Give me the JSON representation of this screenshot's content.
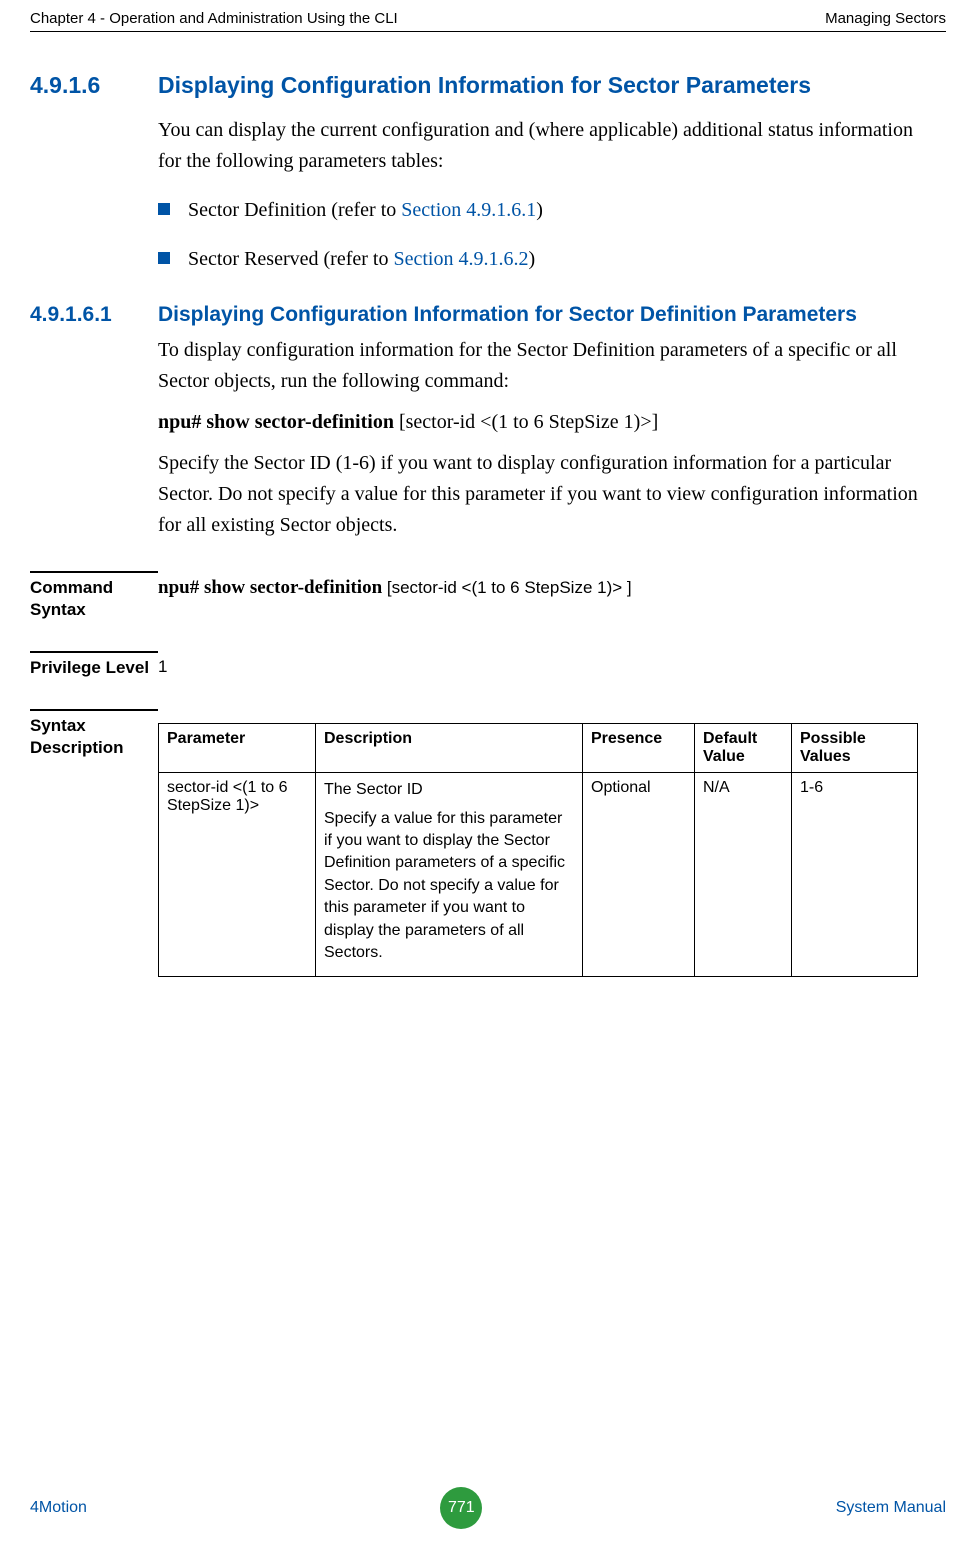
{
  "header": {
    "left": "Chapter 4 - Operation and Administration Using the CLI",
    "right": "Managing Sectors"
  },
  "sec1": {
    "num": "4.9.1.6",
    "title": "Displaying Configuration Information for Sector Parameters",
    "intro": "You can display the current configuration and (where applicable) additional status information for the following parameters tables:",
    "bullet1_pre": "Sector Definition (refer to ",
    "bullet1_link": "Section 4.9.1.6.1",
    "bullet1_post": ")",
    "bullet2_pre": "Sector Reserved (refer to ",
    "bullet2_link": "Section 4.9.1.6.2",
    "bullet2_post": ")"
  },
  "sec2": {
    "num": "4.9.1.6.1",
    "title": "Displaying Configuration Information for Sector Definition Parameters",
    "p1": "To display configuration information for the Sector Definition parameters of a specific or all Sector objects, run the following command:",
    "cmd_bold": "npu# show sector-definition",
    "cmd_rest": " [sector-id <(1 to 6 StepSize 1)>]",
    "p2": "Specify the Sector ID (1-6) if you want to display configuration information for a particular Sector. Do not specify a value for this parameter if you want to view configuration information for all existing Sector objects."
  },
  "defs": {
    "cmd_label": "Command Syntax",
    "cmd_bold": "npu# show sector-definition",
    "cmd_rest": " [sector-id <(1 to 6 StepSize 1)> ]",
    "priv_label": "Privilege Level",
    "priv_value": "1",
    "syn_label": "Syntax Description"
  },
  "table": {
    "headers": {
      "param": "Parameter",
      "desc": "Description",
      "presence": "Presence",
      "default": "Default Value",
      "possible": "Possible Values"
    },
    "row": {
      "param": "sector-id <(1 to 6 StepSize 1)>",
      "desc_p1": "The Sector ID",
      "desc_p2": "Specify a value for this parameter if you want to display the Sector Definition parameters of a specific Sector. Do not specify a value for this parameter if you want to display the parameters of all Sectors.",
      "presence": "Optional",
      "default": "N/A",
      "possible": "1-6"
    }
  },
  "footer": {
    "left": "4Motion",
    "page": "771",
    "right": "System Manual"
  }
}
